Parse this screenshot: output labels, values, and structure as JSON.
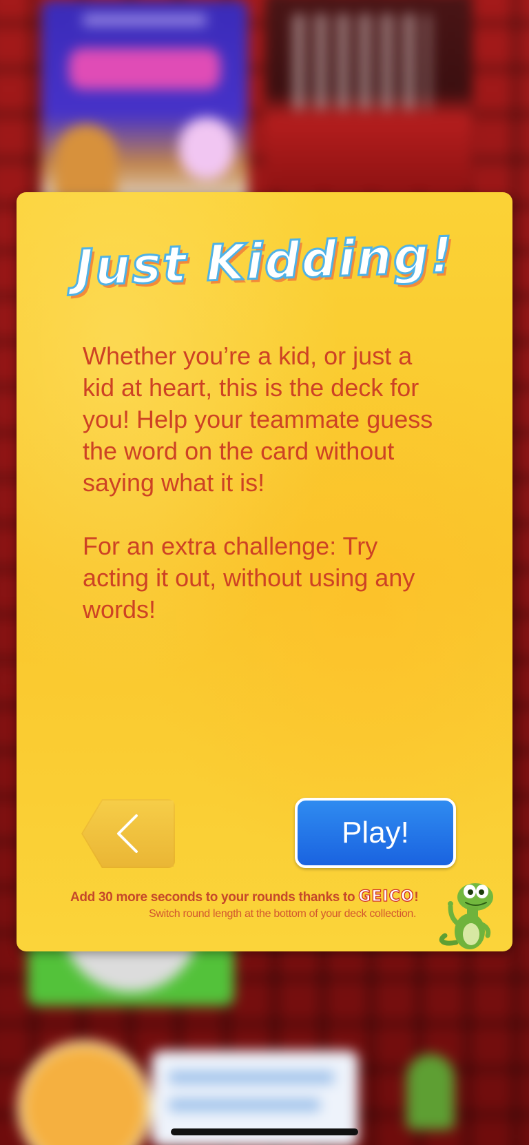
{
  "background": {
    "description": "blurred deck collection behind modal"
  },
  "modal": {
    "title": "Just Kidding!",
    "description_paragraph_1": "Whether you’re a kid, or just a kid at heart, this is the deck for you! Help your teammate guess the word on the card without saying what it is!",
    "description_paragraph_2": "For an extra challenge: Try acting it out, without using any words!",
    "back_icon": "chevron-left-icon",
    "play_label": "Play!",
    "promo_text": "Add 30 more seconds to your rounds thanks to",
    "promo_brand": "GEICO",
    "promo_exclaim": "!",
    "promo_subtext": "Switch round length at the bottom of your deck collection.",
    "mascot_icon": "gecko-mascot-icon"
  },
  "colors": {
    "card_yellow": "#fbd236",
    "text_red": "#cd4224",
    "play_blue": "#1a63e0",
    "title_outline_blue": "#4fb2e6"
  }
}
